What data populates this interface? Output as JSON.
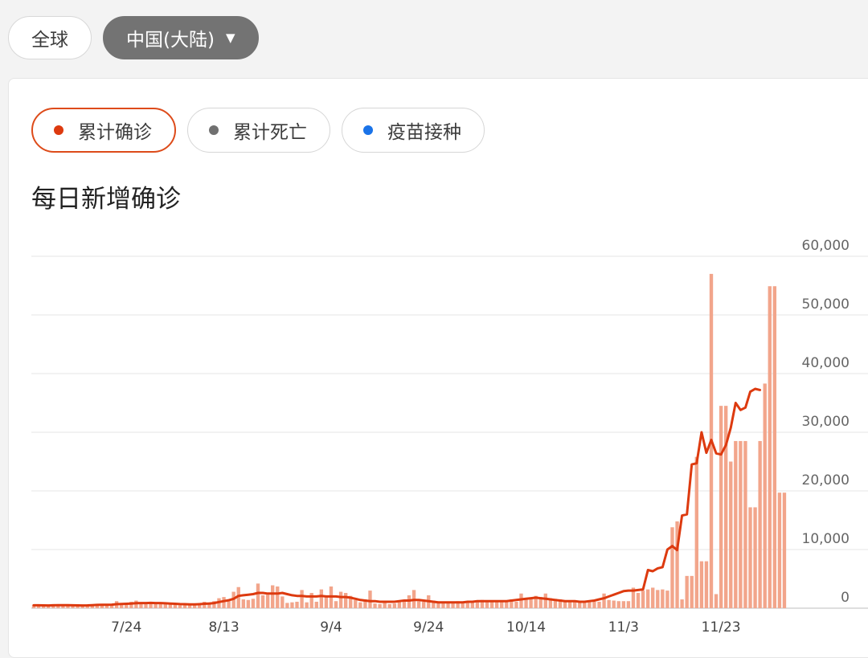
{
  "scope": {
    "global_label": "全球",
    "region_label": "中国(大陆)",
    "region_caret": "▼"
  },
  "metrics": [
    {
      "label": "累计确诊",
      "color": "#dd3a0f",
      "active": true
    },
    {
      "label": "累计死亡",
      "color": "#707070",
      "active": false
    },
    {
      "label": "疫苗接种",
      "color": "#1a73e8",
      "active": false
    }
  ],
  "chart_data": {
    "type": "bar",
    "title": "每日新增确诊",
    "xlabel": "",
    "ylabel": "",
    "ylim": [
      0,
      60000
    ],
    "yticks": [
      0,
      10000,
      20000,
      30000,
      40000,
      50000,
      60000
    ],
    "ytick_labels": [
      "0",
      "10,000",
      "20,000",
      "30,000",
      "40,000",
      "50,000",
      "60,000"
    ],
    "xticks": [
      {
        "label": "7/24",
        "index": 19
      },
      {
        "label": "8/13",
        "index": 39
      },
      {
        "label": "9/4",
        "index": 61
      },
      {
        "label": "9/24",
        "index": 81
      },
      {
        "label": "10/14",
        "index": 101
      },
      {
        "label": "11/3",
        "index": 121
      },
      {
        "label": "11/23",
        "index": 141
      }
    ],
    "grid": true,
    "bar_color": "#f2a58b",
    "line_color": "#dd3a0f",
    "series": [
      {
        "type": "bar",
        "values": [
          600,
          500,
          450,
          400,
          700,
          650,
          550,
          500,
          500,
          450,
          400,
          500,
          600,
          700,
          650,
          500,
          700,
          1200,
          800,
          900,
          1100,
          1300,
          1000,
          900,
          1100,
          800,
          1000,
          700,
          650,
          600,
          500,
          500,
          600,
          750,
          900,
          1100,
          1000,
          1200,
          1700,
          1900,
          1300,
          2800,
          3600,
          1500,
          1400,
          1600,
          4200,
          2200,
          2300,
          3900,
          3700,
          2000,
          900,
          1000,
          1100,
          3100,
          1000,
          2600,
          1100,
          3200,
          2000,
          3700,
          1200,
          2800,
          2600,
          2100,
          1400,
          1000,
          1500,
          3000,
          800,
          700,
          900,
          700,
          800,
          1100,
          1200,
          2200,
          3100,
          1200,
          1100,
          2200,
          1300,
          1100,
          1100,
          1000,
          1000,
          1200,
          1100,
          1200,
          1200,
          1200,
          1400,
          1300,
          1300,
          1200,
          1200,
          1200,
          1500,
          1100,
          2500,
          1600,
          1600,
          2100,
          1900,
          2500,
          1700,
          1600,
          1500,
          1300,
          1300,
          1200,
          1200,
          1300,
          1200,
          1100,
          1100,
          2500,
          1400,
          1300,
          1200,
          1200,
          1200,
          3500,
          2600,
          3000,
          3200,
          3500,
          3100,
          3200,
          3000,
          13800,
          14800,
          1500,
          5500,
          5500,
          25800,
          8000,
          8000,
          57000,
          2400,
          34500,
          34500,
          25000,
          28500,
          28500,
          28500,
          17200,
          17200,
          28500,
          38300,
          54900,
          54900,
          19700,
          19700
        ]
      },
      {
        "type": "line",
        "values": [
          500,
          500,
          480,
          470,
          490,
          520,
          520,
          510,
          500,
          480,
          470,
          480,
          520,
          560,
          580,
          580,
          600,
          680,
          720,
          760,
          800,
          860,
          880,
          880,
          900,
          870,
          880,
          840,
          800,
          760,
          700,
          680,
          660,
          660,
          690,
          750,
          800,
          880,
          1050,
          1200,
          1350,
          1600,
          2100,
          2200,
          2300,
          2400,
          2600,
          2600,
          2500,
          2500,
          2500,
          2600,
          2400,
          2200,
          2100,
          2100,
          2000,
          2000,
          2000,
          2100,
          2000,
          2000,
          2000,
          1900,
          1900,
          1800,
          1600,
          1400,
          1300,
          1200,
          1200,
          1100,
          1100,
          1100,
          1100,
          1200,
          1300,
          1300,
          1400,
          1400,
          1300,
          1200,
          1100,
          1000,
          1000,
          1000,
          1000,
          1000,
          1000,
          1100,
          1100,
          1200,
          1200,
          1200,
          1200,
          1200,
          1200,
          1200,
          1300,
          1400,
          1500,
          1600,
          1700,
          1800,
          1700,
          1600,
          1500,
          1400,
          1300,
          1200,
          1200,
          1200,
          1100,
          1100,
          1200,
          1300,
          1500,
          1700,
          2000,
          2300,
          2600,
          2900,
          3000,
          3000,
          3100,
          3200,
          6500,
          6300,
          6800,
          7000,
          10000,
          10600,
          9900,
          15800,
          16000,
          24500,
          24700,
          30000,
          26500,
          28700,
          26400,
          26200,
          27800,
          30800,
          35000,
          33800,
          34200,
          36900,
          37400,
          37200
        ]
      }
    ]
  }
}
